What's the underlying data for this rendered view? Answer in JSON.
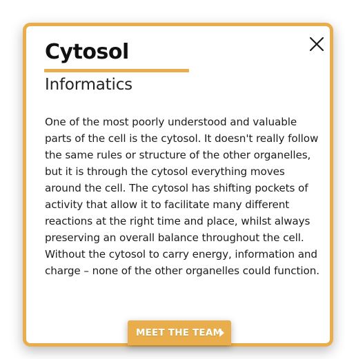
{
  "dialog": {
    "title": "Cytosol",
    "subtitle": "Informatics",
    "body": "One of the most poorly understood and valuable parts of the cell is the cytosol. It doesn't really follow the same rules or structure of the other organelles, but it is through the cytosol everything moves around the cell. The cytosol has shifting pockets of activity that allow it to facilitate many different reactions at the right time and place, whilst always preserving an overall balance throughout the cell. Without the cytosol to carry energy, information and charge – none of the other organelles could function.",
    "close_icon": "close-icon",
    "button_label": "MEET THE TEAM",
    "button_icon": "play-icon"
  },
  "colors": {
    "accent": "#e9ae4b",
    "text": "#1c1c1c",
    "background": "#ffffff"
  }
}
